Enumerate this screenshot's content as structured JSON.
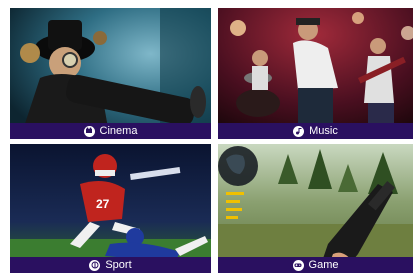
{
  "tiles": [
    {
      "label": "Cinema",
      "icon": "film-icon"
    },
    {
      "label": "Music",
      "icon": "music-note-icon"
    },
    {
      "label": "Sport",
      "icon": "ball-icon"
    },
    {
      "label": "Game",
      "icon": "gamepad-icon"
    }
  ],
  "colors": {
    "label_bar": "#2a1060",
    "label_text": "#ffffff"
  }
}
